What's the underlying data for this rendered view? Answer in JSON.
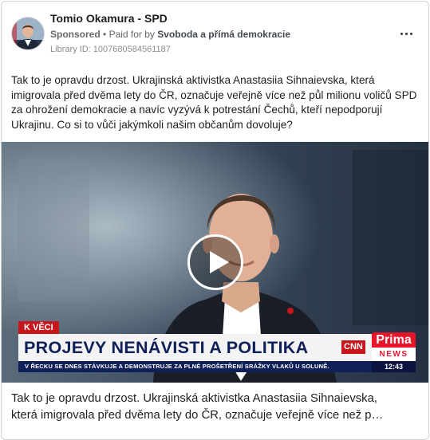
{
  "ad": {
    "page_name": "Tomio Okamura - SPD",
    "sponsored_label": "Sponsored",
    "separator": "•",
    "paid_for_prefix": "Paid for by",
    "paid_for_by": "Svoboda a přímá demokracie",
    "library_id": "Library ID: 1007680584561187",
    "more_icon": "more-options-icon",
    "body_text": "Tak to je opravdu drzost. Ukrajinská aktivistka Anastasiia Sihnaievska, která imigrovala před dvěma lety do ČR, označuje veřejně více než půl milionu voličů SPD za ohrožení demokracie a navíc vyzývá k potrestání Čechů, kteří nepodporují Ukrajinu. Co si to vůči jakýmkoli našim občanům dovoluje?"
  },
  "video": {
    "play_icon": "play-icon",
    "section_tag": "K VĚCI",
    "headline": "PROJEVY NENÁVISTI A POLITIKA",
    "network_cnn": "CNN",
    "network_prima": "Prima",
    "network_news": "NEWS",
    "ticker": "V ŘECKU SE DNES STÁVKUJE A DEMONSTRUJE ZA PLNÉ PROŠETŘENÍ SRÁŽKY VLAKŮ U SOLUNĚ.",
    "time": "12:43"
  },
  "caption": {
    "line1": "Tak to je opravdu drzost. Ukrajinská aktivistka Anastasiia Sihnaievska,",
    "line2": "která imigrovala před dvěma lety do ČR, označuje veřejně více než p…"
  },
  "colors": {
    "brand_red": "#c8161d",
    "headline_navy": "#0f1f58",
    "prima_red": "#e8142a"
  }
}
